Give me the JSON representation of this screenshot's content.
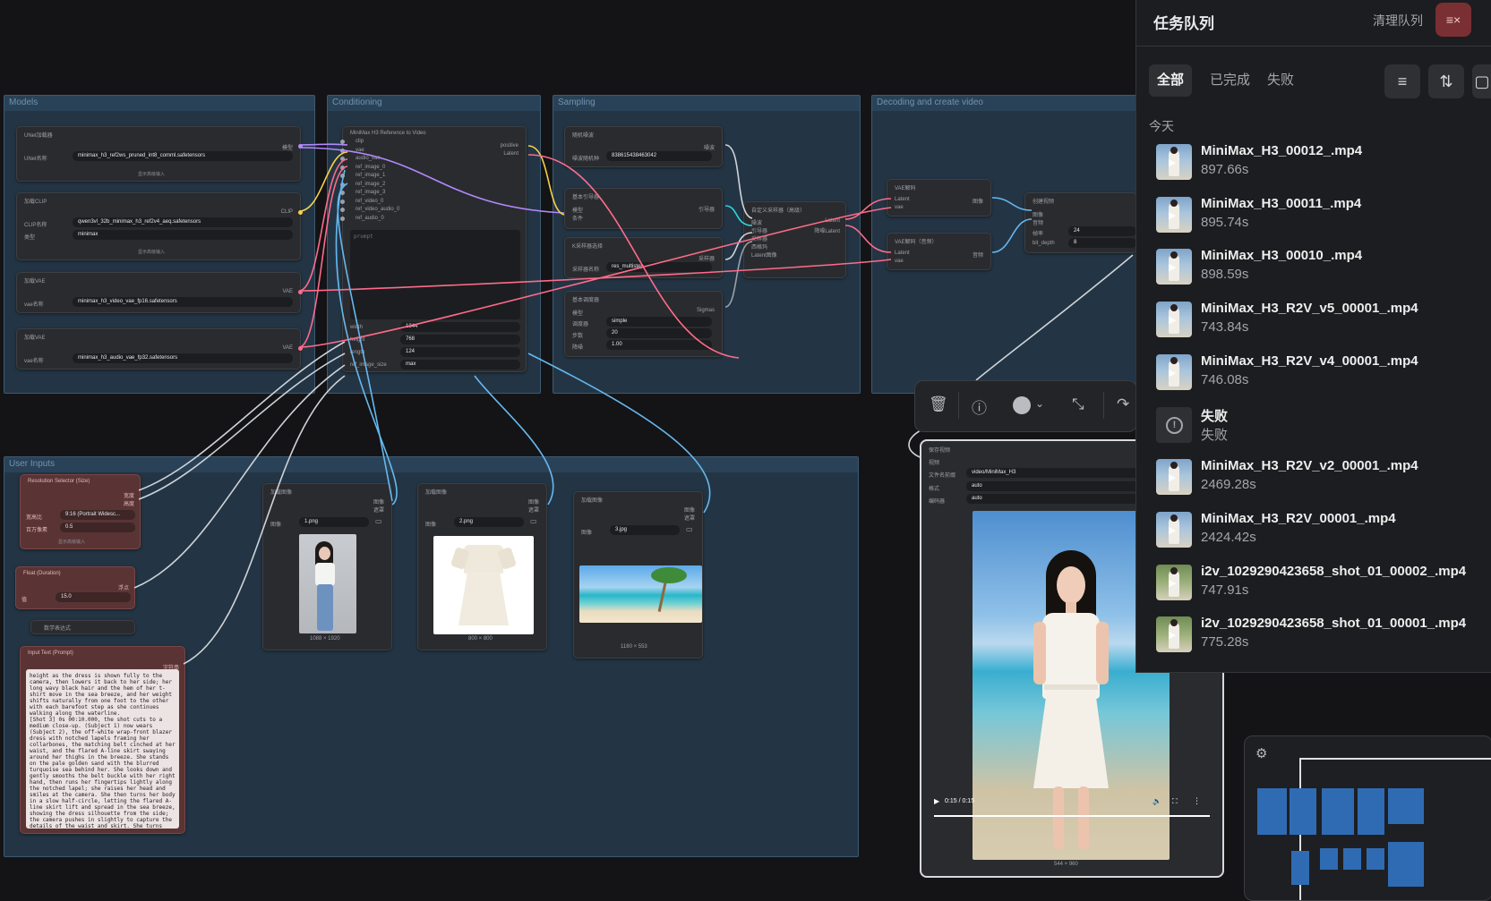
{
  "groups": {
    "models": "Models",
    "conditioning": "Conditioning",
    "sampling": "Sampling",
    "decoding": "Decoding and create video",
    "user_inputs": "User Inputs"
  },
  "nodes": {
    "unet": {
      "title": "UNet加载器",
      "out": "模型",
      "label": "UNet名称",
      "value": "minimax_h3_ref2ws_pruned_int8_comml.safetensors",
      "more": "显示高级输入"
    },
    "clip": {
      "title": "加载CLIP",
      "out": "CLIP",
      "label1": "CLIP名称",
      "value1": "qwen3vl_32b_minimax_h3_ref2v4_aeq.safetensors",
      "label2": "类型",
      "value2": "minimax",
      "more": "显示高级输入"
    },
    "vae1": {
      "title": "加载VAE",
      "out": "VAE",
      "label": "vae名称",
      "value": "minimax_h3_video_vae_fp16.safetensors"
    },
    "vae2": {
      "title": "加载VAE",
      "out": "VAE",
      "label": "vae名称",
      "value": "minimax_h3_audio_vae_fp32.safetensors"
    },
    "ref": {
      "title": "MiniMax H3 Reference to Video",
      "inputs": [
        "clip",
        "vae",
        "audio_vae",
        "ref_image_0",
        "ref_image_1",
        "ref_image_2",
        "ref_image_3",
        "ref_video_0",
        "ref_video_audio_0",
        "ref_audio_0"
      ],
      "outputs": [
        "positive",
        "Latent"
      ],
      "prompt_label": "prompt",
      "width_label": "width",
      "width": "1344",
      "height_label": "height",
      "height": "768",
      "length_label": "length",
      "length": "124",
      "size_label": "ref_image_size",
      "size": "max"
    },
    "noise": {
      "title": "随机噪波",
      "out": "噪波",
      "label": "噪波随机种",
      "value": "838615438463042"
    },
    "guider": {
      "title": "基本引导器",
      "out": "引导器",
      "in1": "模型",
      "in2": "条件"
    },
    "ksampler": {
      "title": "K采样器选择",
      "out": "采样器",
      "label": "采样器名称",
      "value": "res_multistep"
    },
    "scheduler": {
      "title": "基本调度器",
      "in": "模型",
      "out": "Sigmas",
      "l1": "调度器",
      "v1": "simple",
      "l2": "步数",
      "v2": "20",
      "l3": "降噪",
      "v3": "1.00"
    },
    "custom": {
      "title": "自定义采样器（高级）",
      "inputs": [
        "噪波",
        "引导器",
        "采样器",
        "西格玛",
        "Latent图像"
      ],
      "out1": "Latent",
      "out2": "降噪Latent"
    },
    "vaedec1": {
      "title": "VAE解码",
      "in1": "Latent",
      "in2": "vae",
      "out": "图像"
    },
    "vaedec2": {
      "title": "VAE解码（音频）",
      "in1": "Latent",
      "in2": "vae",
      "out": "音频"
    },
    "create": {
      "title": "创建视频",
      "in1": "图像",
      "in2": "音频",
      "l1": "帧率",
      "v1": "24",
      "l2": "bit_depth",
      "v2": "8"
    },
    "res": {
      "title": "Resolution Selector (Size)",
      "out1": "宽度",
      "out2": "高度",
      "l1": "宽高比",
      "v1": "9:16 (Portrait Widesc...",
      "l2": "百万像素",
      "v2": "0.5",
      "more": "显示高级输入"
    },
    "float": {
      "title": "Float (Duration)",
      "out": "浮点",
      "label": "值",
      "value": "15.0"
    },
    "math": {
      "title": "数学表达式"
    },
    "prompt": {
      "title": "Input Text (Prompt)",
      "out": "字符串",
      "text": "height as the dress is shown fully to the camera, then lowers it back to her side; her long wavy black hair and the hem of her t-shirt move in the sea breeze, and her weight shifts naturally from one foot to the other with each barefoot step as she continues walking along the waterline.\n[Shot 3] 0s 00:10.000, the shot cuts to a medium close-up. (Subject 1) now wears (Subject 2), the off-white wrap-front blazer dress with notched lapels framing her collarbones, the matching belt cinched at her waist, and the flared A-line skirt swaying around her thighs in the breeze. She stands on the pale golden sand with the blurred turquoise sea behind her. She looks down and gently smooths the belt buckle with her right hand, then runs her fingertips lightly along the notched lapel; she raises her head and smiles at the camera. She then turns her body in a slow half-circle, letting the flared A-line skirt lift and spread in the sea breeze, showing the dress silhouette from the side; the camera pushes in slightly to capture the details of the waist and skirt. She turns back to face the camera, gives a confident smile, and the shot holds the final composition as her hair and the dress hem move gently in the breeze."
    },
    "img1": {
      "title": "加载图像",
      "out1": "图像",
      "out2": "遮罩",
      "label": "图像",
      "file": "1.png",
      "size": "1088 × 1920"
    },
    "img2": {
      "title": "加载图像",
      "out1": "图像",
      "out2": "遮罩",
      "label": "图像",
      "file": "2.png",
      "size": "800 × 800"
    },
    "img3": {
      "title": "加载图像",
      "out1": "图像",
      "out2": "遮罩",
      "label": "图像",
      "file": "3.jpg",
      "size": "1180 × 553"
    },
    "save": {
      "title": "保存视频",
      "in": "视频",
      "l1": "文件名前缀",
      "v1": "video/MiniMax_H3",
      "l2": "格式",
      "v2": "auto",
      "l3": "编码器",
      "v3": "auto",
      "time": "0:15 / 0:15",
      "size": "544 × 960"
    }
  },
  "queue": {
    "title": "任务队列",
    "clear": "清理队列",
    "tabs": [
      "全部",
      "已完成",
      "失败"
    ],
    "group": "今天",
    "items": [
      {
        "name": "MiniMax_H3_00012_.mp4",
        "time": "897.66s",
        "kind": "beach"
      },
      {
        "name": "MiniMax_H3_00011_.mp4",
        "time": "895.74s",
        "kind": "beach"
      },
      {
        "name": "MiniMax_H3_00010_.mp4",
        "time": "898.59s",
        "kind": "beach"
      },
      {
        "name": "MiniMax_H3_R2V_v5_00001_.mp4",
        "time": "743.84s",
        "kind": "beach"
      },
      {
        "name": "MiniMax_H3_R2V_v4_00001_.mp4",
        "time": "746.08s",
        "kind": "beach"
      },
      {
        "name": "失败",
        "time": "失败",
        "kind": "fail"
      },
      {
        "name": "MiniMax_H3_R2V_v2_00001_.mp4",
        "time": "2469.28s",
        "kind": "beach"
      },
      {
        "name": "MiniMax_H3_R2V_00001_.mp4",
        "time": "2424.42s",
        "kind": "beach"
      },
      {
        "name": "i2v_1029290423658_shot_01_00002_.mp4",
        "time": "747.91s",
        "kind": "green"
      },
      {
        "name": "i2v_1029290423658_shot_01_00001_.mp4",
        "time": "775.28s",
        "kind": "green"
      }
    ]
  },
  "colors": {
    "accent": "#2f6bb3",
    "danger": "#7a2f33",
    "wire_clip": "#f5d14a",
    "wire_vae": "#ff6b8b",
    "wire_image": "#66b8f0"
  }
}
